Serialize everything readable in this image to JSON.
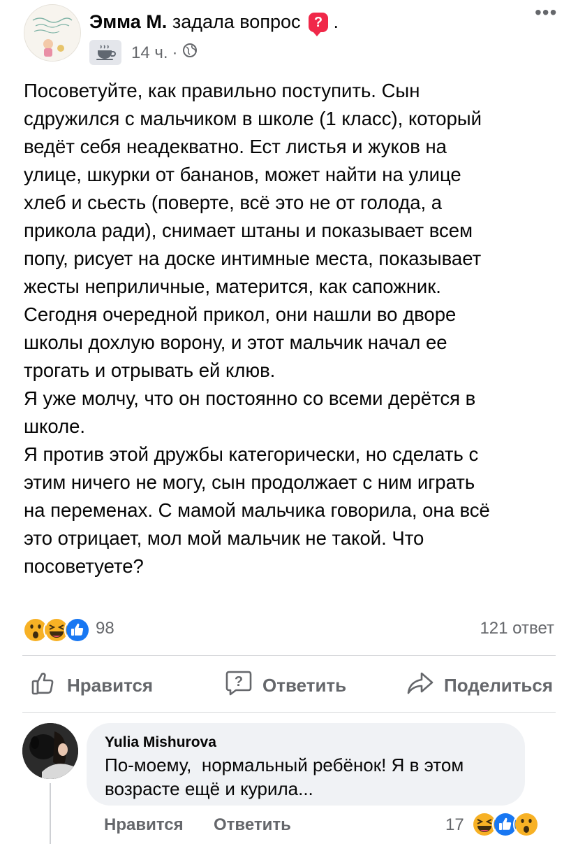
{
  "post": {
    "author": "Эмма М.",
    "action_text": "задала вопрос",
    "period": ".",
    "time": "14 ч.",
    "dot": "·",
    "body": "Посоветуйте, как правильно поступить. Сын\nсдружился с мальчиком в школе (1 класс), который\nведёт себя неадекватно. Ест листья и жуков на\nулице, шкурки от бананов, может найти на улице\nхлеб и сьесть (поверте, всё это не от голода, а\nприкола ради), снимает штаны и показывает всем\nпопу, рисует на доске интимные места, показывает\nжесты неприличные, матерится, как сапожник.\nСегодня очередной прикол, они нашли во дворе\nшколы дохлую ворону, и этот мальчик начал ее\nтрогать и отрывать ей клюв.\nЯ уже молчу, что он постоянно со всеми дерётся в\nшколе.\nЯ против этой дружбы категорически, но сделать с\nэтим ничего не могу, сын продолжает с ним играть\nна переменах. С мамой мальчика говорила, она всё\nэто отрицает, мол мой мальчик не такой. Что\nпосоветуете?",
    "reaction_count": "98",
    "answers_count": "121 ответ",
    "reactions": [
      "wow-icon",
      "haha-icon",
      "like-icon"
    ]
  },
  "actions": {
    "like": "Нравится",
    "answer": "Ответить",
    "share": "Поделиться"
  },
  "comment": {
    "author": "Yulia Mishurova",
    "text": "По-моему,  нормальный ребёнок! Я в этом\nвозрасте ещё и курила...",
    "like": "Нравится",
    "reply": "Ответить",
    "reaction_count": "17",
    "reactions": [
      "haha-icon",
      "like-icon",
      "wow-icon"
    ]
  },
  "colors": {
    "text": "#050505",
    "secondary": "#65676b",
    "ask_badge": "#f02849",
    "like_blue": "#1877f2",
    "emoji_yellow": "#f7b125",
    "bubble_bg": "#f0f2f5"
  }
}
